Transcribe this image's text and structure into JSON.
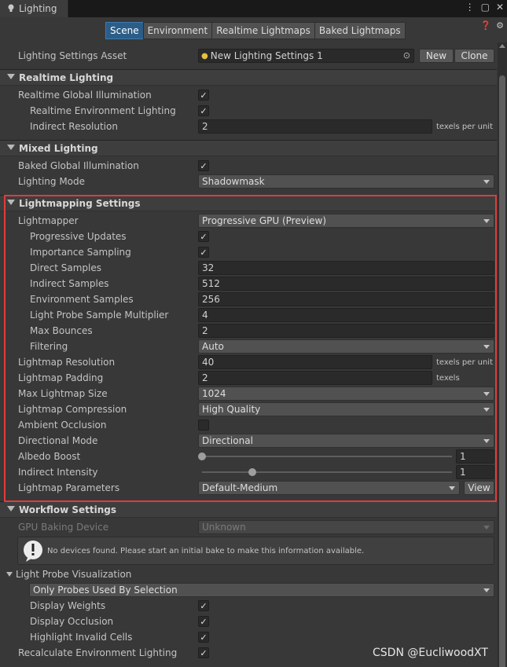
{
  "window": {
    "tab_title": "Lighting",
    "tab_icon": "lightbulb-icon",
    "menu_icon": "kebab-menu-icon",
    "maximize_icon": "maximize-icon",
    "close_icon": "close-icon"
  },
  "subtabs": [
    {
      "label": "Scene",
      "active": true
    },
    {
      "label": "Environment",
      "active": false
    },
    {
      "label": "Realtime Lightmaps",
      "active": false
    },
    {
      "label": "Baked Lightmaps",
      "active": false
    }
  ],
  "header": {
    "help_icon": "help-icon",
    "settings_icon": "gear-icon",
    "asset_label": "Lighting Settings Asset",
    "asset_value": "New Lighting Settings 1",
    "new_label": "New",
    "clone_label": "Clone"
  },
  "realtime": {
    "title": "Realtime Lighting",
    "gi_label": "Realtime Global Illumination",
    "gi_checked": true,
    "env_label": "Realtime Environment Lighting",
    "env_checked": true,
    "indirect_res_label": "Indirect Resolution",
    "indirect_res_value": "2",
    "indirect_res_unit": "texels per unit"
  },
  "mixed": {
    "title": "Mixed Lighting",
    "baked_gi_label": "Baked Global Illumination",
    "baked_gi_checked": true,
    "mode_label": "Lighting Mode",
    "mode_value": "Shadowmask"
  },
  "lightmapping": {
    "title": "Lightmapping Settings",
    "lightmapper_label": "Lightmapper",
    "lightmapper_value": "Progressive GPU (Preview)",
    "progressive_updates_label": "Progressive Updates",
    "progressive_updates_checked": true,
    "importance_sampling_label": "Importance Sampling",
    "importance_sampling_checked": true,
    "direct_samples_label": "Direct Samples",
    "direct_samples_value": "32",
    "indirect_samples_label": "Indirect Samples",
    "indirect_samples_value": "512",
    "env_samples_label": "Environment Samples",
    "env_samples_value": "256",
    "probe_mult_label": "Light Probe Sample Multiplier",
    "probe_mult_value": "4",
    "max_bounces_label": "Max Bounces",
    "max_bounces_value": "2",
    "filtering_label": "Filtering",
    "filtering_value": "Auto",
    "resolution_label": "Lightmap Resolution",
    "resolution_value": "40",
    "resolution_unit": "texels per unit",
    "padding_label": "Lightmap Padding",
    "padding_value": "2",
    "padding_unit": "texels",
    "max_size_label": "Max Lightmap Size",
    "max_size_value": "1024",
    "compression_label": "Lightmap Compression",
    "compression_value": "High Quality",
    "ao_label": "Ambient Occlusion",
    "ao_checked": false,
    "directional_label": "Directional Mode",
    "directional_value": "Directional",
    "albedo_label": "Albedo Boost",
    "albedo_value": "1",
    "albedo_fraction": 0.0,
    "indirect_intensity_label": "Indirect Intensity",
    "indirect_intensity_value": "1",
    "indirect_intensity_fraction": 0.2,
    "params_label": "Lightmap Parameters",
    "params_value": "Default-Medium",
    "view_label": "View"
  },
  "workflow": {
    "title": "Workflow Settings",
    "device_label": "GPU Baking Device",
    "device_value": "Unknown",
    "help_icon": "warning-icon",
    "help_message": "No devices found. Please start an initial bake to make this information available."
  },
  "probe_vis": {
    "title": "Light Probe Visualization",
    "mode_value": "Only Probes Used By Selection",
    "weights_label": "Display Weights",
    "weights_checked": true,
    "occlusion_label": "Display Occlusion",
    "occlusion_checked": true,
    "invalid_label": "Highlight Invalid Cells",
    "invalid_checked": true,
    "recalc_label": "Recalculate Environment Lighting",
    "recalc_checked": true
  },
  "watermark": "CSDN @EucliwoodXT",
  "colors": {
    "highlight_border": "#e03c3c",
    "active_tab": "#2c5d87",
    "background": "#383838"
  }
}
